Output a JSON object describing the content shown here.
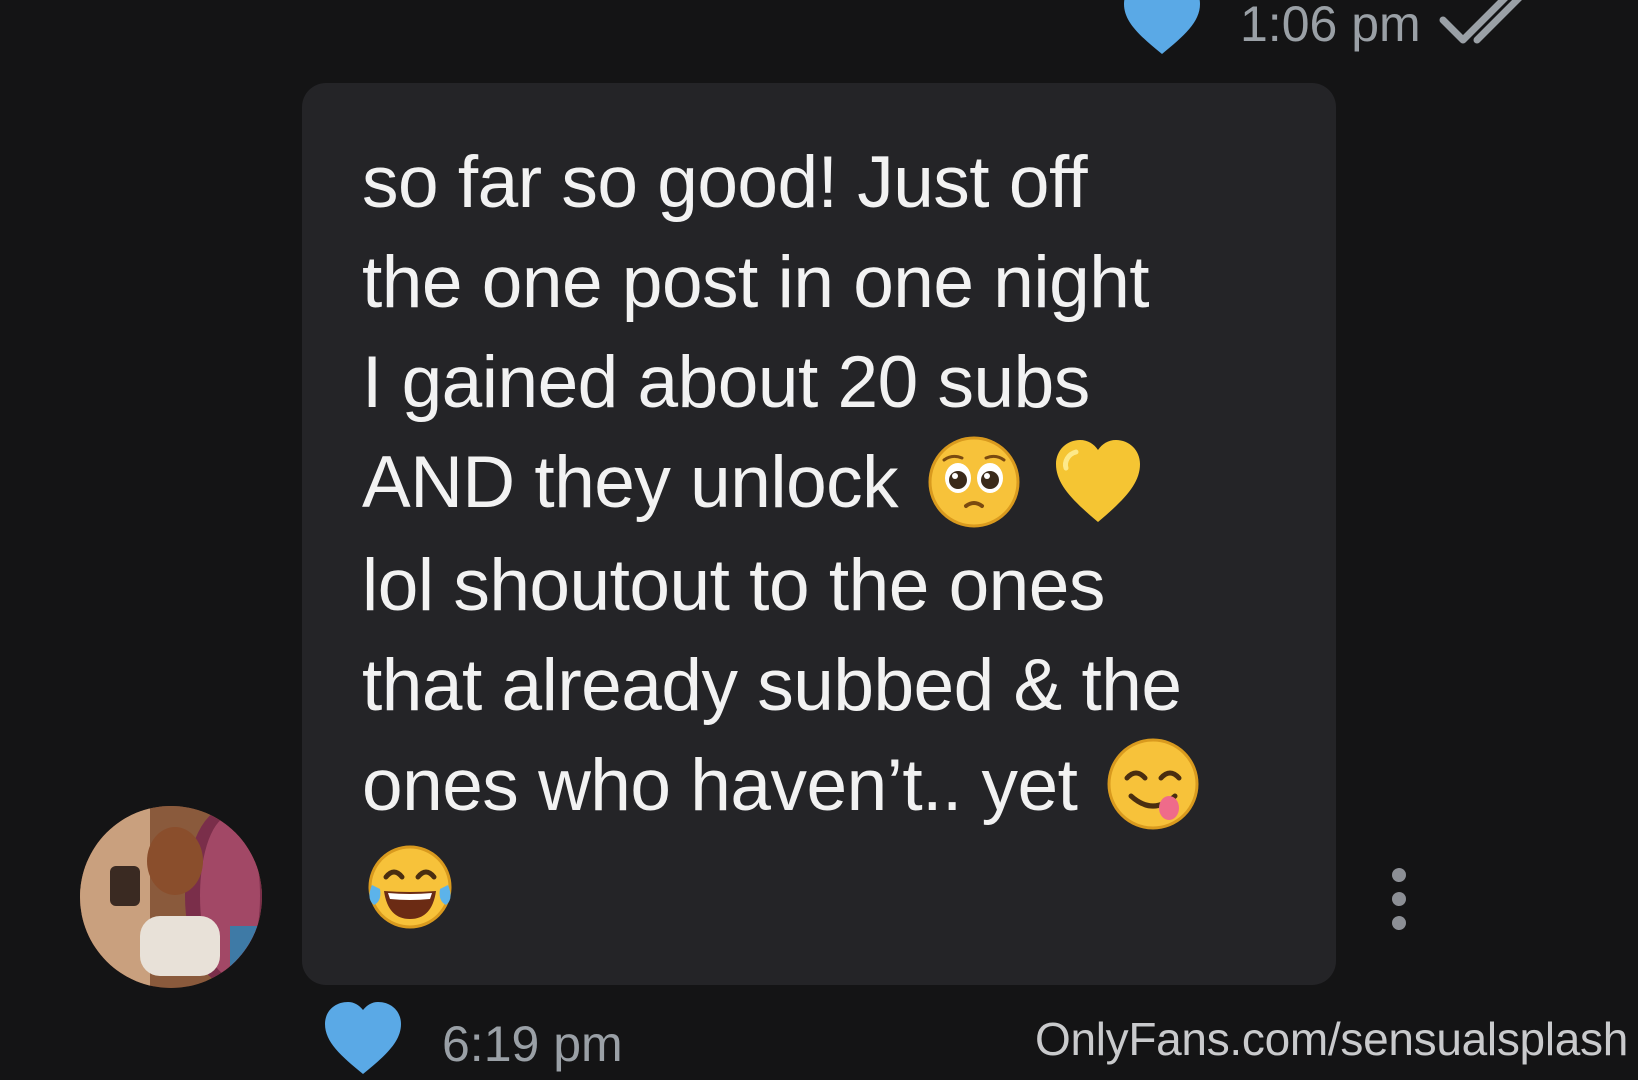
{
  "previous_message": {
    "time": "1:06 pm",
    "liked": true,
    "read_status_icon": "double-check-icon"
  },
  "message": {
    "lines": [
      "so far so good! Just off",
      "the one post in one night",
      "I gained about 20 subs",
      "AND they unlock",
      "lol shoutout to the ones",
      "that already subbed & the",
      "ones who haven’t.. yet",
      ""
    ],
    "emojis": {
      "line4": [
        "pleading-face-emoji",
        "yellow-heart-emoji"
      ],
      "line7": [
        "face-savoring-food-emoji"
      ],
      "line8": [
        "tears-of-joy-emoji"
      ]
    },
    "time": "6:19 pm",
    "liked": true
  },
  "sender": {
    "avatar_icon": "avatar"
  },
  "watermark": "OnlyFans.com/sensualsplash",
  "colors": {
    "background": "#141415",
    "bubble": "#242427",
    "heart": "#5aa9e6",
    "text": "#f2f2f2",
    "meta": "#9aa0a6"
  }
}
